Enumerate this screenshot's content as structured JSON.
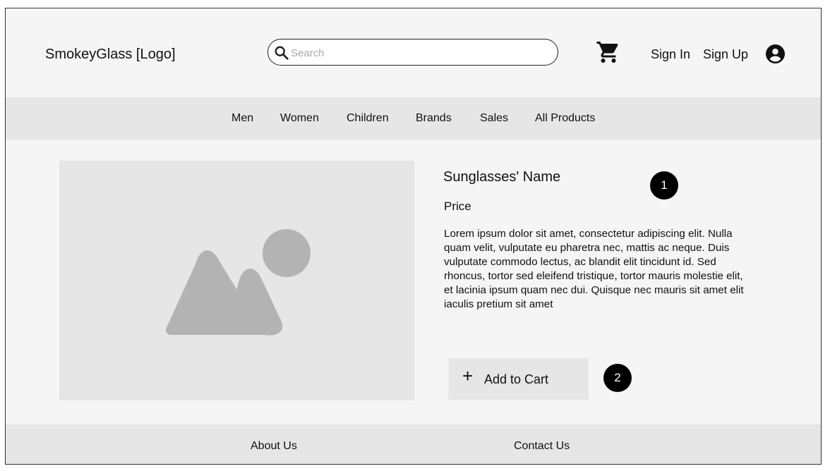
{
  "header": {
    "logo": "SmokeyGlass [Logo]",
    "search_placeholder": "Search",
    "sign_in": "Sign In",
    "sign_up": "Sign Up"
  },
  "icons": {
    "search": "search-icon",
    "cart": "shopping-cart-icon",
    "account": "account-circle-icon",
    "image": "image-placeholder-icon",
    "plus": "plus-icon"
  },
  "nav": {
    "items": [
      {
        "label": "Men"
      },
      {
        "label": "Women"
      },
      {
        "label": "Children"
      },
      {
        "label": "Brands"
      },
      {
        "label": "Sales"
      },
      {
        "label": "All Products"
      }
    ]
  },
  "product": {
    "name": "Sunglasses' Name",
    "price": "Price",
    "description": "Lorem ipsum dolor sit amet, consectetur adipiscing elit. Nulla quam velit, vulputate eu pharetra nec, mattis ac neque. Duis vulputate commodo lectus, ac blandit elit tincidunt id. Sed rhoncus, tortor sed eleifend tristique, tortor mauris molestie elit, et lacinia ipsum quam nec dui. Quisque nec mauris sit amet elit iaculis pretium sit amet",
    "add_to_cart": "Add to Cart",
    "plus_symbol": "+"
  },
  "annotations": {
    "badge_1": "1",
    "badge_2": "2"
  },
  "footer": {
    "about": "About Us",
    "contact": "Contact Us"
  },
  "colors": {
    "page_background": "#f5f5f5",
    "bar_background": "#e6e6e6",
    "placeholder_shape": "#b3b3b3",
    "badge": "#000000"
  }
}
